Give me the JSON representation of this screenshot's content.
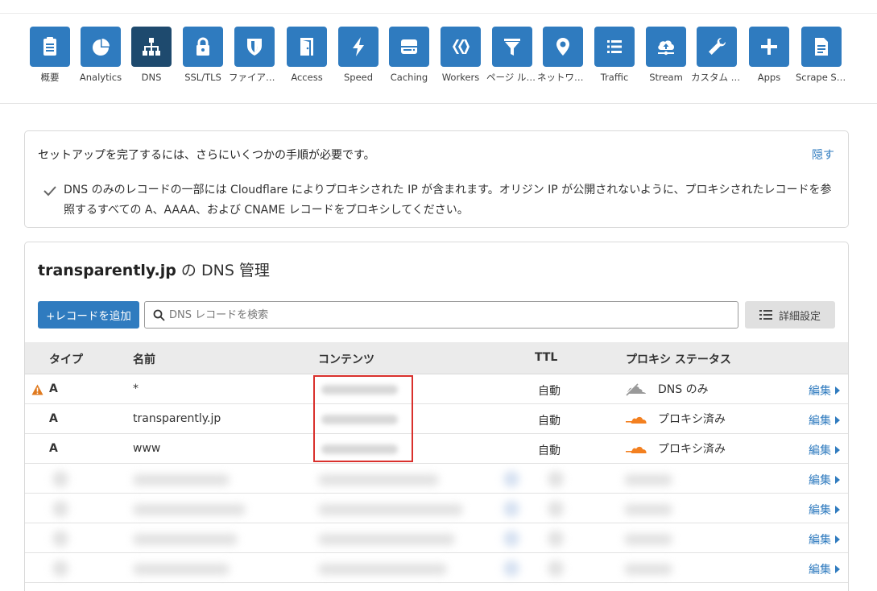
{
  "nav": {
    "items": [
      {
        "label": "概要",
        "icon": "clipboard-icon",
        "active": false
      },
      {
        "label": "Analytics",
        "icon": "pie-chart-icon",
        "active": false
      },
      {
        "label": "DNS",
        "icon": "network-icon",
        "active": true
      },
      {
        "label": "SSL/TLS",
        "icon": "lock-icon",
        "active": false
      },
      {
        "label": "ファイアウォ...",
        "icon": "shield-icon",
        "active": false
      },
      {
        "label": "Access",
        "icon": "door-icon",
        "active": false
      },
      {
        "label": "Speed",
        "icon": "lightning-icon",
        "active": false
      },
      {
        "label": "Caching",
        "icon": "server-icon",
        "active": false
      },
      {
        "label": "Workers",
        "icon": "workers-icon",
        "active": false
      },
      {
        "label": "ページ ルール",
        "icon": "filter-icon",
        "active": false
      },
      {
        "label": "ネットワーク",
        "icon": "location-pin-icon",
        "active": false
      },
      {
        "label": "Traffic",
        "icon": "list-icon",
        "active": false
      },
      {
        "label": "Stream",
        "icon": "cloud-upload-icon",
        "active": false
      },
      {
        "label": "カスタム ペ...",
        "icon": "wrench-icon",
        "active": false
      },
      {
        "label": "Apps",
        "icon": "plus-icon",
        "active": false
      },
      {
        "label": "Scrape Shi...",
        "icon": "document-icon",
        "active": false
      }
    ]
  },
  "setup": {
    "title": "セットアップを完了するには、さらにいくつかの手順が必要です。",
    "hide": "隠す",
    "message": "DNS のみのレコードの一部には Cloudflare によりプロキシされた IP が含まれます。オリジン IP が公開されないように、プロキシされたレコードを参照するすべての A、AAAA、および CNAME レコードをプロキシしてください。"
  },
  "dns": {
    "domain": "transparently.jp",
    "title_suffix": " の DNS 管理",
    "add_button": "+レコードを追加",
    "search_placeholder": "DNS レコードを検索",
    "advanced_button": "詳細設定",
    "columns": {
      "type": "タイプ",
      "name": "名前",
      "content": "コンテンツ",
      "ttl": "TTL",
      "proxy": "プロキシ ステータス"
    },
    "edit_label": "編集",
    "records": [
      {
        "type": "A",
        "name": "*",
        "ttl": "自動",
        "proxy": "DNS のみ",
        "proxied": false,
        "warning": true
      },
      {
        "type": "A",
        "name": "transparently.jp",
        "ttl": "自動",
        "proxy": "プロキシ済み",
        "proxied": true,
        "warning": false
      },
      {
        "type": "A",
        "name": "www",
        "ttl": "自動",
        "proxy": "プロキシ済み",
        "proxied": true,
        "warning": false
      }
    ]
  },
  "colors": {
    "accent": "#2f7bbf",
    "nav_active": "#1e4a6e",
    "proxied_orange": "#f38020",
    "highlight": "#d9302c"
  }
}
